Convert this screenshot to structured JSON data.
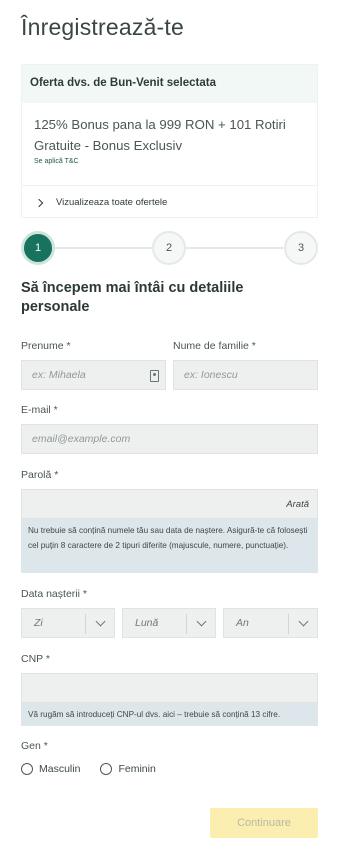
{
  "page": {
    "title": "Înregistrează-te"
  },
  "offer": {
    "header": "Oferta dvs. de Bun-Venit selectata",
    "text": "125% Bonus pana la 999 RON + 101 Rotiri Gratuite - Bonus Exclusiv",
    "tc": "Se aplică T&C",
    "view_all": "Vizualizeaza toate ofertele"
  },
  "steps": [
    "1",
    "2",
    "3"
  ],
  "form": {
    "section_title": "Să începem mai întâi cu detaliile personale",
    "first_name": {
      "label": "Prenume *",
      "placeholder": "ex: Mihaela"
    },
    "last_name": {
      "label": "Nume de familie *",
      "placeholder": "ex: Ionescu"
    },
    "email": {
      "label": "E-mail *",
      "placeholder": "email@example.com"
    },
    "password": {
      "label": "Parolă *",
      "reveal": "Arată",
      "hint": "Nu trebuie să conțină numele tău sau data de naștere. Asigură-te că folosești cel puțin 8 caractere de 2 tipuri diferite (majuscule, numere, punctuație)."
    },
    "birth": {
      "label": "Data nașterii *",
      "day": "Zi",
      "month": "Lună",
      "year": "An"
    },
    "cnp": {
      "label": "CNP *",
      "hint": "Vă rugăm să introduceți CNP-ul dvs. aici – trebuie să conțină 13 cifre."
    },
    "gender": {
      "label": "Gen *",
      "male": "Masculin",
      "female": "Feminin"
    },
    "continue": "Continuare"
  }
}
